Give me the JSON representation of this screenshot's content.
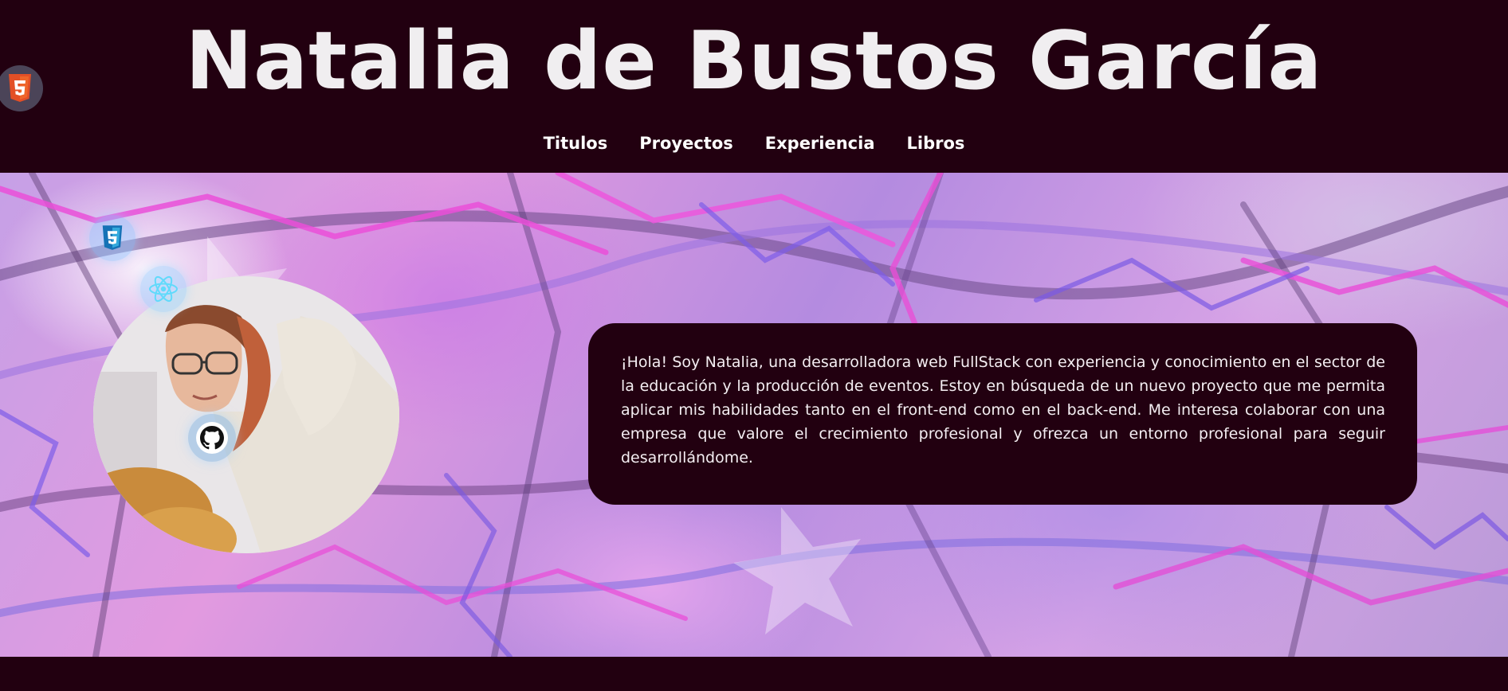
{
  "header": {
    "title": "Natalia de Bustos García"
  },
  "nav": {
    "items": [
      {
        "label": "Titulos"
      },
      {
        "label": "Proyectos"
      },
      {
        "label": "Experiencia"
      },
      {
        "label": "Libros"
      }
    ]
  },
  "badges": [
    {
      "icon": "html5-icon",
      "color": "#e34f26"
    },
    {
      "icon": "css3-icon",
      "color": "#1572b6"
    },
    {
      "icon": "react-icon",
      "color": "#61dafb"
    },
    {
      "icon": "github-icon",
      "color": "#111111"
    }
  ],
  "hero": {
    "intro": "¡Hola! Soy Natalia, una desarrolladora web FullStack con experiencia y conocimiento en el sector de la educación y la producción de eventos. Estoy en búsqueda de un nuevo proyecto que me permita aplicar mis habilidades tanto en el front-end como en el back-end. Me interesa colaborar con una empresa que valore el crecimiento profesional y ofrezca un entorno profesional para seguir desarrollándome."
  },
  "colors": {
    "background": "#220010",
    "text": "#f0eef0",
    "accent_pink": "#e24fd6",
    "accent_violet": "#7d5ce8"
  }
}
